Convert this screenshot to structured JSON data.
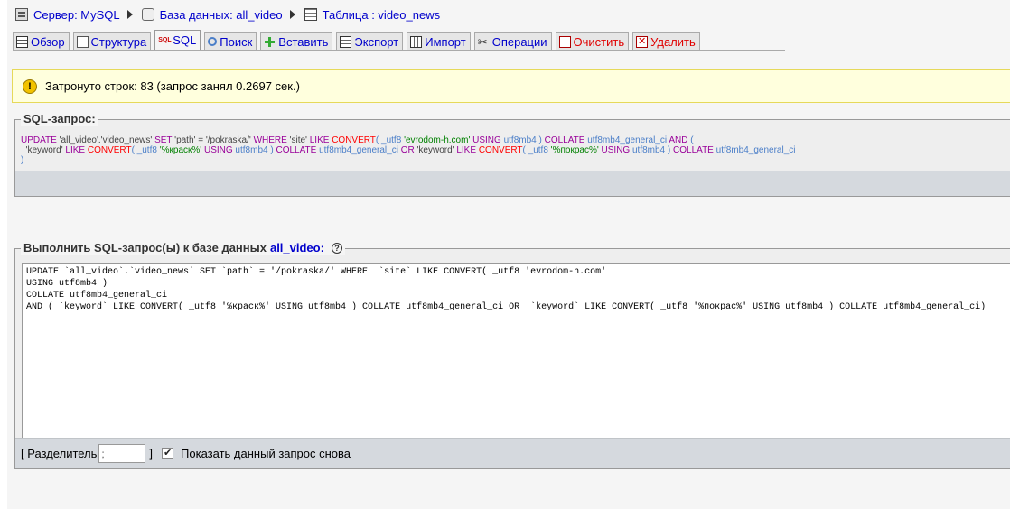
{
  "breadcrumb": {
    "server": "Сервер: MySQL",
    "database": "База данных: all_video",
    "table": "Таблица : video_news"
  },
  "tabs": [
    {
      "label": "Обзор",
      "icon": "browse-icon"
    },
    {
      "label": "Структура",
      "icon": "structure-icon"
    },
    {
      "label": "SQL",
      "icon": "sql-icon",
      "active": true
    },
    {
      "label": "Поиск",
      "icon": "search-icon"
    },
    {
      "label": "Вставить",
      "icon": "insert-icon"
    },
    {
      "label": "Экспорт",
      "icon": "export-icon"
    },
    {
      "label": "Импорт",
      "icon": "import-icon"
    },
    {
      "label": "Операции",
      "icon": "operations-icon"
    },
    {
      "label": "Очистить",
      "icon": "empty-icon",
      "danger": true
    },
    {
      "label": "Удалить",
      "icon": "drop-icon",
      "danger": true
    }
  ],
  "notice": {
    "text": "Затронуто строк: 83 (запрос занял 0.2697 сек.)",
    "icon": "warning-icon",
    "background": "#ffffdd"
  },
  "sql_query": {
    "legend": "SQL-запрос:",
    "lines": [
      [
        {
          "t": "UPDATE",
          "c": "kw"
        },
        {
          "t": " 'all_video'.'video_news' ",
          "c": "col"
        },
        {
          "t": "SET",
          "c": "kw"
        },
        {
          "t": " 'path' = '/pokraska/' ",
          "c": "col"
        },
        {
          "t": "WHERE",
          "c": "kw"
        },
        {
          "t": " 'site' ",
          "c": "col"
        },
        {
          "t": "LIKE",
          "c": "kw"
        },
        {
          "t": " ",
          "c": "col"
        },
        {
          "t": "CONVERT",
          "c": "fn"
        },
        {
          "t": "( _utf8 ",
          "c": "cs"
        },
        {
          "t": "'evrodom-h.com'",
          "c": "str"
        },
        {
          "t": " ",
          "c": "col"
        },
        {
          "t": "USING",
          "c": "kw"
        },
        {
          "t": " utf8mb4 ) ",
          "c": "cs"
        },
        {
          "t": "COLLATE",
          "c": "kw"
        },
        {
          "t": " utf8mb4_general_ci ",
          "c": "cs"
        },
        {
          "t": "AND",
          "c": "kw"
        },
        {
          "t": " (",
          "c": "cs"
        }
      ],
      [
        {
          "t": "  'keyword' ",
          "c": "col"
        },
        {
          "t": "LIKE",
          "c": "kw"
        },
        {
          "t": " ",
          "c": "col"
        },
        {
          "t": "CONVERT",
          "c": "fn"
        },
        {
          "t": "( _utf8 ",
          "c": "cs"
        },
        {
          "t": "'%краск%'",
          "c": "str"
        },
        {
          "t": " ",
          "c": "col"
        },
        {
          "t": "USING",
          "c": "kw"
        },
        {
          "t": " utf8mb4 ) ",
          "c": "cs"
        },
        {
          "t": "COLLATE",
          "c": "kw"
        },
        {
          "t": " utf8mb4_general_ci ",
          "c": "cs"
        },
        {
          "t": "OR",
          "c": "kw"
        },
        {
          "t": " 'keyword' ",
          "c": "col"
        },
        {
          "t": "LIKE",
          "c": "kw"
        },
        {
          "t": " ",
          "c": "col"
        },
        {
          "t": "CONVERT",
          "c": "fn"
        },
        {
          "t": "( _utf8 ",
          "c": "cs"
        },
        {
          "t": "'%покрас%'",
          "c": "str"
        },
        {
          "t": " ",
          "c": "col"
        },
        {
          "t": "USING",
          "c": "kw"
        },
        {
          "t": " utf8mb4 ) ",
          "c": "cs"
        },
        {
          "t": "COLLATE",
          "c": "kw"
        },
        {
          "t": " utf8mb4_general_ci",
          "c": "cs"
        }
      ],
      [
        {
          "t": ")",
          "c": "cs"
        }
      ]
    ]
  },
  "run_sql": {
    "legend": "Выполнить SQL-запрос(ы) к базе данных",
    "database": "all_video:",
    "editor_text": "UPDATE `all_video`.`video_news` SET `path` = '/pokraska/' WHERE  `site` LIKE CONVERT( _utf8 'evrodom-h.com'\nUSING utf8mb4 )\nCOLLATE utf8mb4_general_ci\nAND ( `keyword` LIKE CONVERT( _utf8 '%краск%' USING utf8mb4 ) COLLATE utf8mb4_general_ci OR  `keyword` LIKE CONVERT( _utf8 '%покрас%' USING utf8mb4 ) COLLATE utf8mb4_general_ci)",
    "delimiter_label_open": "[ Разделитель",
    "delimiter_value": ";",
    "delimiter_label_close": "]",
    "show_query_label": "Показать данный запрос снова",
    "show_query_checked": true
  }
}
